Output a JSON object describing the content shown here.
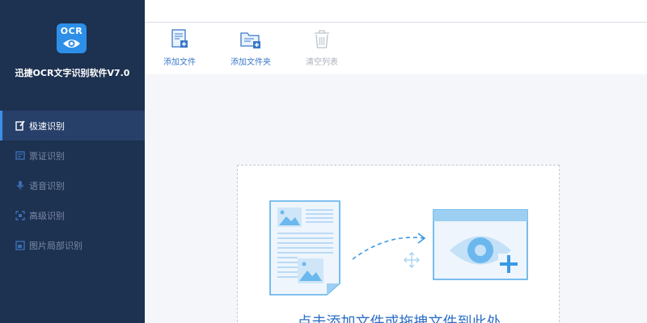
{
  "app": {
    "title": "迅捷OCR文字识别软件V7.0",
    "logo_text": "OCR"
  },
  "sidebar": {
    "items": [
      {
        "label": "极速识别",
        "icon": "quick-edit-icon",
        "active": true
      },
      {
        "label": "票证识别",
        "icon": "ticket-icon",
        "active": false
      },
      {
        "label": "语音识别",
        "icon": "microphone-icon",
        "active": false
      },
      {
        "label": "高级识别",
        "icon": "scan-frame-icon",
        "active": false
      },
      {
        "label": "图片局部识别",
        "icon": "image-crop-icon",
        "active": false
      }
    ]
  },
  "toolbar": {
    "add_file": "添加文件",
    "add_folder": "添加文件夹",
    "clear_list": "清空列表"
  },
  "dropzone": {
    "text": "点击添加文件或拖拽文件到此处"
  },
  "colors": {
    "sidebar": "#1d3150",
    "accent": "#2d8fe8",
    "link": "#3c78c9"
  }
}
